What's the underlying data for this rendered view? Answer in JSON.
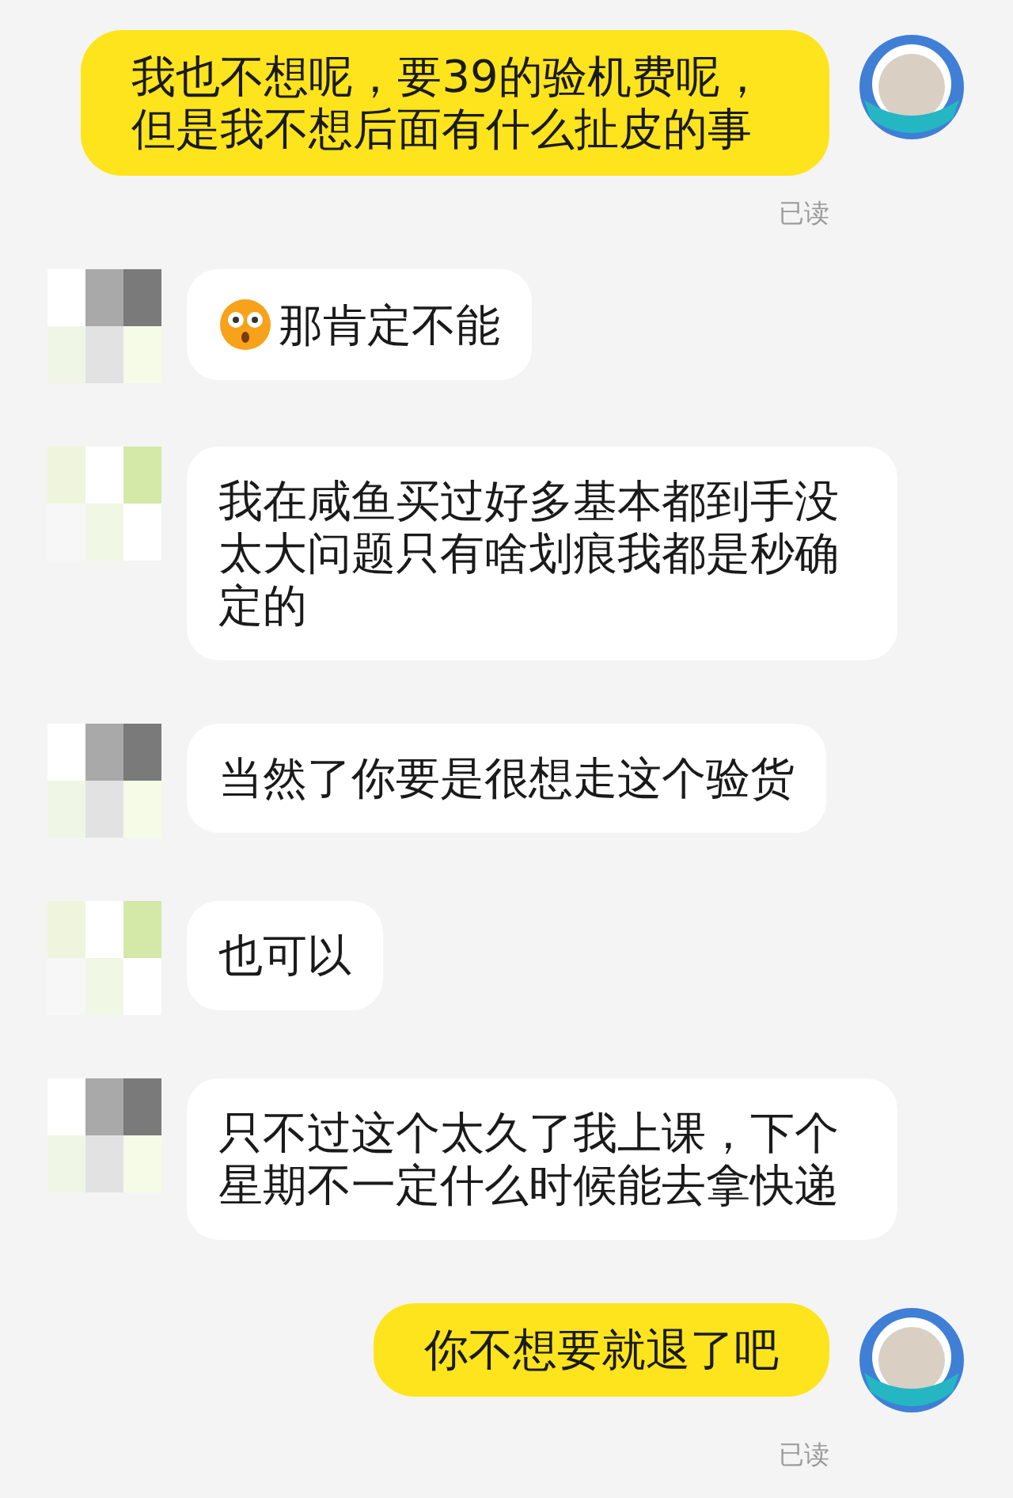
{
  "messages": [
    {
      "kind": "sent",
      "text": "我也不想呢，要39的验机费呢，但是我不想后面有什么扯皮的事",
      "emoji": false,
      "receipt": "已读"
    },
    {
      "kind": "received",
      "text": "那肯定不能",
      "emoji": true
    },
    {
      "kind": "received",
      "text": "我在咸鱼买过好多基本都到手没太大问题只有啥划痕我都是秒确定的",
      "emoji": false
    },
    {
      "kind": "received",
      "text": "当然了你要是很想走这个验货",
      "emoji": false
    },
    {
      "kind": "received",
      "text": "也可以",
      "emoji": false
    },
    {
      "kind": "received",
      "text": "只不过这个太久了我上课，下个星期不一定什么时候能去拿快递",
      "emoji": false
    },
    {
      "kind": "sent",
      "text": "你不想要就退了吧",
      "emoji": false,
      "receipt": "已读"
    }
  ]
}
